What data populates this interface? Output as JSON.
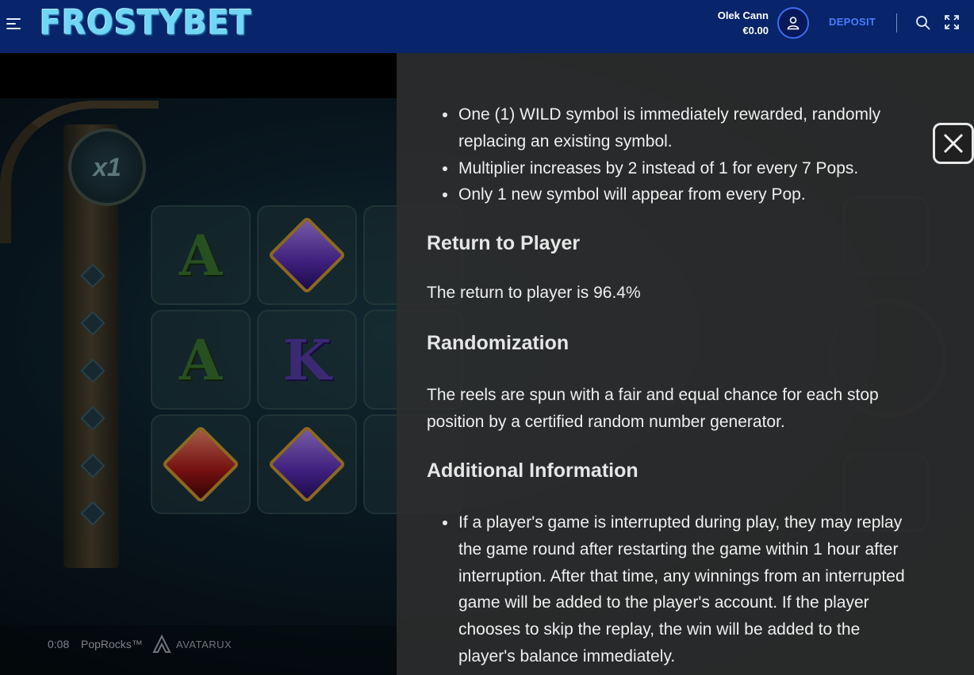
{
  "header": {
    "logo_text": "FROSTYBET",
    "user_name": "Olek Cann",
    "balance": "€0.00",
    "deposit_label": "DEPOSIT",
    "icons": [
      "menu-icon",
      "user-icon",
      "search-icon",
      "fullscreen-icon"
    ]
  },
  "game": {
    "multiplier": "x1",
    "time": "0:08",
    "title": "PopRocks™",
    "provider": "AVATARUX"
  },
  "info": {
    "feature_bullets": [
      "One (1) WILD symbol is immediately rewarded, randomly replacing an existing symbol.",
      "Multiplier increases by 2 instead of 1 for every 7 Pops.",
      "Only 1 new symbol will appear from every Pop."
    ],
    "rtp_heading": "Return to Player",
    "rtp_text": "The return to player is 96.4%",
    "randomization_heading": "Randomization",
    "randomization_text": "The reels are spun with a fair and equal chance for each stop position by a certified random number generator.",
    "additional_heading": "Additional Information",
    "additional_bullets": [
      "If a player's game is interrupted during play, they may replay the game round after restarting the game within 1 hour after interruption. After that time, any winnings from an interrupted game will be added to the player's account. If the player chooses to skip the replay, the win will be added to the player's balance immediately."
    ]
  },
  "colors": {
    "header_bg": "#08246a",
    "deposit": "#4a7cff",
    "panel_bg": "#2e2e2e",
    "logo": "#6fd6f6"
  }
}
